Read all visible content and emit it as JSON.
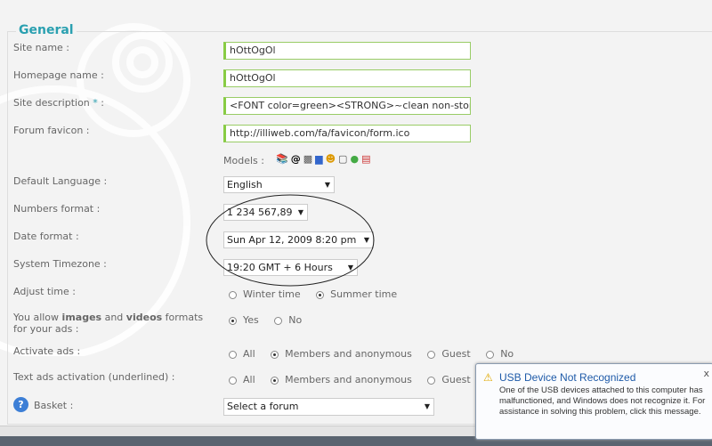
{
  "section_title": "General",
  "fields": {
    "site_name": {
      "label": "Site name :",
      "value": "hOttOgOl"
    },
    "homepage_name": {
      "label": "Homepage name :",
      "value": "hOttOgOl"
    },
    "site_description": {
      "label": "Site description",
      "required": "*",
      "colon": ":",
      "value": "<FONT color=green><STRONG>~clean non-stop f"
    },
    "forum_favicon": {
      "label": "Forum favicon :",
      "value": "http://illiweb.com/fa/favicon/form.ico"
    },
    "models_label": "Models :",
    "models_icons": [
      "books-icon",
      "spiral-icon",
      "pattern-icon",
      "monitor-icon",
      "smiley-icon",
      "speech-bubble-icon",
      "globe-icon",
      "notepad-icon"
    ],
    "default_language": {
      "label": "Default Language :",
      "value": "English"
    },
    "numbers_format": {
      "label": "Numbers format :",
      "value": "1 234 567,89"
    },
    "date_format": {
      "label": "Date format :",
      "value": "Sun Apr 12, 2009 8:20 pm"
    },
    "timezone": {
      "label": "System Timezone :",
      "value": "19:20 GMT + 6 Hours"
    },
    "adjust_time": {
      "label": "Adjust time :",
      "options": [
        "Winter time",
        "Summer time"
      ],
      "selected": "Summer time"
    },
    "allow_media": {
      "label_pre": "You allow ",
      "b1": "images",
      "mid": " and ",
      "b2": "videos",
      "label_post": " formats",
      "label_line2": "for your ads :",
      "options": [
        "Yes",
        "No"
      ],
      "selected": "Yes"
    },
    "activate_ads": {
      "label": "Activate ads :",
      "options": [
        "All",
        "Members and anonymous",
        "Guest",
        "No"
      ],
      "selected": "Members and anonymous"
    },
    "text_ads": {
      "label": "Text ads activation (underlined) :",
      "options": [
        "All",
        "Members and anonymous",
        "Guest"
      ],
      "selected": "Members and anonymous"
    },
    "basket": {
      "label": "Basket :",
      "value": "Select a forum"
    }
  },
  "notification": {
    "title": "USB Device Not Recognized",
    "body": "One of the USB devices attached to this computer has malfunctioned, and Windows does not recognize it. For assistance in solving this problem, click this message.",
    "close": "x"
  },
  "colors": {
    "accent": "#2aa0b0",
    "input_border": "#8cc44a",
    "toast_title": "#1e5aa8"
  }
}
